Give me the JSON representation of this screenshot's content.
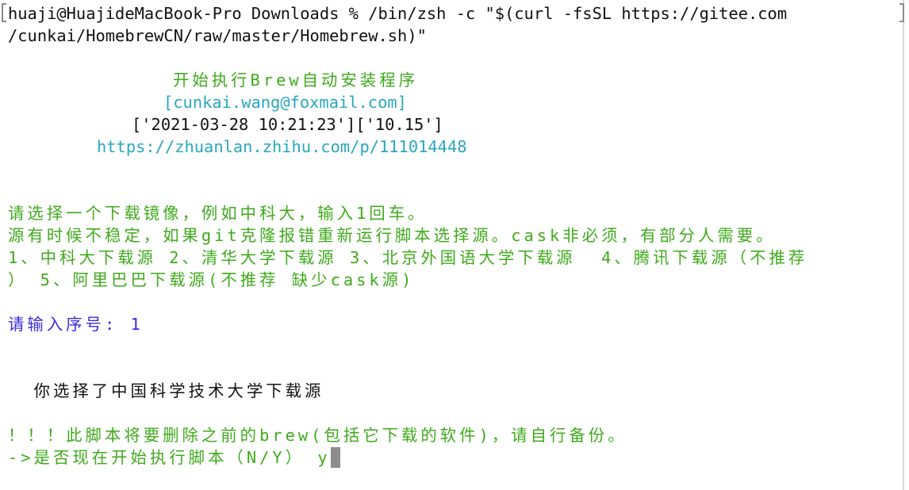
{
  "terminal": {
    "command_line_1": "huaji@HuajideMacBook-Pro Downloads % /bin/zsh -c \"$(curl -fsSL https://gitee.com",
    "command_line_2": "/cunkai/HomebrewCN/raw/master/Homebrew.sh)\"",
    "banner_title": "开始执行Brew自动安装程序",
    "banner_email": "[cunkai.wang@foxmail.com]",
    "banner_date": "['2021-03-28 10:21:23']['10.15']",
    "banner_url": "https://zhuanlan.zhihu.com/p/111014448",
    "mirror_prompt": "请选择一个下载镜像，例如中科大，输入1回车。",
    "mirror_note": "源有时候不稳定，如果git克隆报错重新运行脚本选择源。cask非必须，有部分人需要。",
    "mirror_options_1": "1、中科大下载源 2、清华大学下载源 3、北京外国语大学下载源  4、腾讯下载源（不推荐",
    "mirror_options_2": "） 5、阿里巴巴下载源(不推荐 缺少cask源)",
    "input_prompt": "请输入序号: 1",
    "selection_result": "  你选择了中国科学技术大学下载源",
    "warning": "！！！此脚本将要删除之前的brew(包括它下载的软件)，请自行备份。",
    "confirm_prompt": "->是否现在开始执行脚本（N/Y） ",
    "confirm_answer": "y"
  },
  "colors": {
    "green": "#3faa1c",
    "cyan": "#29a7bf",
    "blue": "#3a2be0",
    "text": "#111111",
    "cursor": "#8c8c8c"
  }
}
